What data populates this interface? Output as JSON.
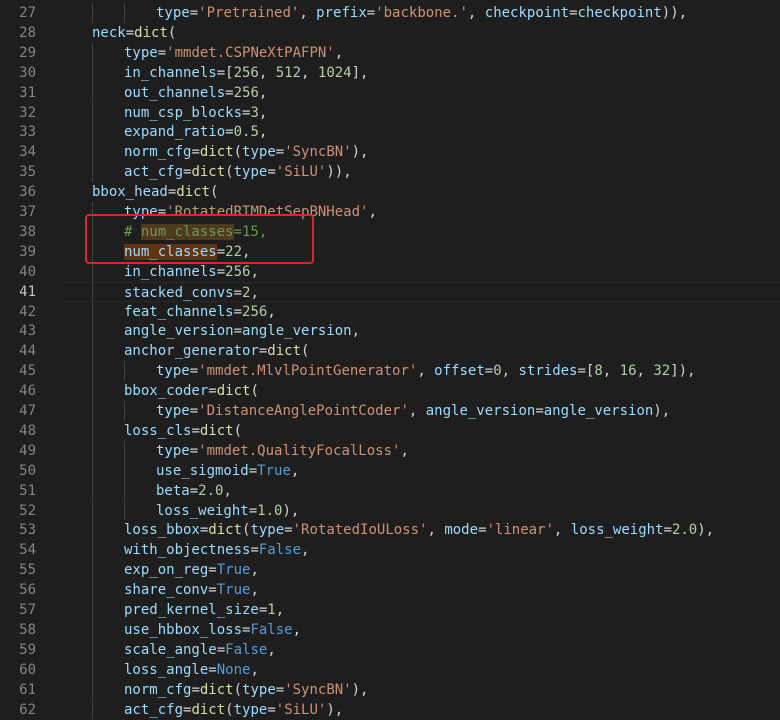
{
  "editor": {
    "active_line": 41,
    "lines": [
      {
        "n": "27",
        "indent": 3,
        "tokens": [
          [
            "k",
            "type"
          ],
          [
            "p",
            "="
          ],
          [
            "s",
            "'Pretrained'"
          ],
          [
            "p",
            ", "
          ],
          [
            "k",
            "prefix"
          ],
          [
            "p",
            "="
          ],
          [
            "s",
            "'backbone.'"
          ],
          [
            "p",
            ", "
          ],
          [
            "k",
            "checkpoint"
          ],
          [
            "p",
            "="
          ],
          [
            "k",
            "checkpoint"
          ],
          [
            "p",
            ")),"
          ]
        ]
      },
      {
        "n": "28",
        "indent": 1,
        "tokens": [
          [
            "k",
            "neck"
          ],
          [
            "p",
            "="
          ],
          [
            "f",
            "dict"
          ],
          [
            "p",
            "("
          ]
        ]
      },
      {
        "n": "29",
        "indent": 2,
        "tokens": [
          [
            "k",
            "type"
          ],
          [
            "p",
            "="
          ],
          [
            "s",
            "'mmdet.CSPNeXtPAFPN'"
          ],
          [
            "p",
            ","
          ]
        ]
      },
      {
        "n": "30",
        "indent": 2,
        "tokens": [
          [
            "k",
            "in_channels"
          ],
          [
            "p",
            "=["
          ],
          [
            "n",
            "256"
          ],
          [
            "p",
            ", "
          ],
          [
            "n",
            "512"
          ],
          [
            "p",
            ", "
          ],
          [
            "n",
            "1024"
          ],
          [
            "p",
            "],"
          ]
        ]
      },
      {
        "n": "31",
        "indent": 2,
        "tokens": [
          [
            "k",
            "out_channels"
          ],
          [
            "p",
            "="
          ],
          [
            "n",
            "256"
          ],
          [
            "p",
            ","
          ]
        ]
      },
      {
        "n": "32",
        "indent": 2,
        "tokens": [
          [
            "k",
            "num_csp_blocks"
          ],
          [
            "p",
            "="
          ],
          [
            "n",
            "3"
          ],
          [
            "p",
            ","
          ]
        ]
      },
      {
        "n": "33",
        "indent": 2,
        "tokens": [
          [
            "k",
            "expand_ratio"
          ],
          [
            "p",
            "="
          ],
          [
            "n",
            "0.5"
          ],
          [
            "p",
            ","
          ]
        ]
      },
      {
        "n": "34",
        "indent": 2,
        "tokens": [
          [
            "k",
            "norm_cfg"
          ],
          [
            "p",
            "="
          ],
          [
            "f",
            "dict"
          ],
          [
            "p",
            "("
          ],
          [
            "k",
            "type"
          ],
          [
            "p",
            "="
          ],
          [
            "s",
            "'SyncBN'"
          ],
          [
            "p",
            "),"
          ]
        ]
      },
      {
        "n": "35",
        "indent": 2,
        "tokens": [
          [
            "k",
            "act_cfg"
          ],
          [
            "p",
            "="
          ],
          [
            "f",
            "dict"
          ],
          [
            "p",
            "("
          ],
          [
            "k",
            "type"
          ],
          [
            "p",
            "="
          ],
          [
            "s",
            "'SiLU'"
          ],
          [
            "p",
            ")),"
          ]
        ]
      },
      {
        "n": "36",
        "indent": 1,
        "tokens": [
          [
            "k",
            "bbox_head"
          ],
          [
            "p",
            "="
          ],
          [
            "f",
            "dict"
          ],
          [
            "p",
            "("
          ]
        ]
      },
      {
        "n": "37",
        "indent": 2,
        "tokens": [
          [
            "k",
            "type"
          ],
          [
            "p",
            "="
          ],
          [
            "s",
            "'RotatedRTMDetSepBNHead'"
          ],
          [
            "p",
            ","
          ]
        ]
      },
      {
        "n": "38",
        "indent": 2,
        "tokens": [
          [
            "c",
            "# "
          ],
          [
            "c",
            "num_classes",
            "hl-find2"
          ],
          [
            "c",
            "=15,"
          ]
        ]
      },
      {
        "n": "39",
        "indent": 2,
        "tokens": [
          [
            "k",
            "num_classes",
            "hl-find"
          ],
          [
            "p",
            "="
          ],
          [
            "n",
            "22"
          ],
          [
            "p",
            ","
          ]
        ]
      },
      {
        "n": "40",
        "indent": 2,
        "tokens": [
          [
            "k",
            "in_channels"
          ],
          [
            "p",
            "="
          ],
          [
            "n",
            "256"
          ],
          [
            "p",
            ","
          ]
        ]
      },
      {
        "n": "41",
        "indent": 2,
        "tokens": [
          [
            "k",
            "stacked_convs"
          ],
          [
            "p",
            "="
          ],
          [
            "n",
            "2"
          ],
          [
            "p",
            ","
          ]
        ]
      },
      {
        "n": "42",
        "indent": 2,
        "tokens": [
          [
            "k",
            "feat_channels"
          ],
          [
            "p",
            "="
          ],
          [
            "n",
            "256"
          ],
          [
            "p",
            ","
          ]
        ]
      },
      {
        "n": "43",
        "indent": 2,
        "tokens": [
          [
            "k",
            "angle_version"
          ],
          [
            "p",
            "="
          ],
          [
            "k",
            "angle_version"
          ],
          [
            "p",
            ","
          ]
        ]
      },
      {
        "n": "44",
        "indent": 2,
        "tokens": [
          [
            "k",
            "anchor_generator"
          ],
          [
            "p",
            "="
          ],
          [
            "f",
            "dict"
          ],
          [
            "p",
            "("
          ]
        ]
      },
      {
        "n": "45",
        "indent": 3,
        "tokens": [
          [
            "k",
            "type"
          ],
          [
            "p",
            "="
          ],
          [
            "s",
            "'mmdet.MlvlPointGenerator'"
          ],
          [
            "p",
            ", "
          ],
          [
            "k",
            "offset"
          ],
          [
            "p",
            "="
          ],
          [
            "n",
            "0"
          ],
          [
            "p",
            ", "
          ],
          [
            "k",
            "strides"
          ],
          [
            "p",
            "=["
          ],
          [
            "n",
            "8"
          ],
          [
            "p",
            ", "
          ],
          [
            "n",
            "16"
          ],
          [
            "p",
            ", "
          ],
          [
            "n",
            "32"
          ],
          [
            "p",
            "]),"
          ]
        ]
      },
      {
        "n": "46",
        "indent": 2,
        "tokens": [
          [
            "k",
            "bbox_coder"
          ],
          [
            "p",
            "="
          ],
          [
            "f",
            "dict"
          ],
          [
            "p",
            "("
          ]
        ]
      },
      {
        "n": "47",
        "indent": 3,
        "tokens": [
          [
            "k",
            "type"
          ],
          [
            "p",
            "="
          ],
          [
            "s",
            "'DistanceAnglePointCoder'"
          ],
          [
            "p",
            ", "
          ],
          [
            "k",
            "angle_version"
          ],
          [
            "p",
            "="
          ],
          [
            "k",
            "angle_version"
          ],
          [
            "p",
            "),"
          ]
        ]
      },
      {
        "n": "48",
        "indent": 2,
        "tokens": [
          [
            "k",
            "loss_cls"
          ],
          [
            "p",
            "="
          ],
          [
            "f",
            "dict"
          ],
          [
            "p",
            "("
          ]
        ]
      },
      {
        "n": "49",
        "indent": 3,
        "tokens": [
          [
            "k",
            "type"
          ],
          [
            "p",
            "="
          ],
          [
            "s",
            "'mmdet.QualityFocalLoss'"
          ],
          [
            "p",
            ","
          ]
        ]
      },
      {
        "n": "50",
        "indent": 3,
        "tokens": [
          [
            "k",
            "use_sigmoid"
          ],
          [
            "p",
            "="
          ],
          [
            "b",
            "True"
          ],
          [
            "p",
            ","
          ]
        ]
      },
      {
        "n": "51",
        "indent": 3,
        "tokens": [
          [
            "k",
            "beta"
          ],
          [
            "p",
            "="
          ],
          [
            "n",
            "2.0"
          ],
          [
            "p",
            ","
          ]
        ]
      },
      {
        "n": "52",
        "indent": 3,
        "tokens": [
          [
            "k",
            "loss_weight"
          ],
          [
            "p",
            "="
          ],
          [
            "n",
            "1.0"
          ],
          [
            "p",
            "),"
          ]
        ]
      },
      {
        "n": "53",
        "indent": 2,
        "tokens": [
          [
            "k",
            "loss_bbox"
          ],
          [
            "p",
            "="
          ],
          [
            "f",
            "dict"
          ],
          [
            "p",
            "("
          ],
          [
            "k",
            "type"
          ],
          [
            "p",
            "="
          ],
          [
            "s",
            "'RotatedIoULoss'"
          ],
          [
            "p",
            ", "
          ],
          [
            "k",
            "mode"
          ],
          [
            "p",
            "="
          ],
          [
            "s",
            "'linear'"
          ],
          [
            "p",
            ", "
          ],
          [
            "k",
            "loss_weight"
          ],
          [
            "p",
            "="
          ],
          [
            "n",
            "2.0"
          ],
          [
            "p",
            "),"
          ]
        ]
      },
      {
        "n": "54",
        "indent": 2,
        "tokens": [
          [
            "k",
            "with_objectness"
          ],
          [
            "p",
            "="
          ],
          [
            "b",
            "False"
          ],
          [
            "p",
            ","
          ]
        ]
      },
      {
        "n": "55",
        "indent": 2,
        "tokens": [
          [
            "k",
            "exp_on_reg"
          ],
          [
            "p",
            "="
          ],
          [
            "b",
            "True"
          ],
          [
            "p",
            ","
          ]
        ]
      },
      {
        "n": "56",
        "indent": 2,
        "tokens": [
          [
            "k",
            "share_conv"
          ],
          [
            "p",
            "="
          ],
          [
            "b",
            "True"
          ],
          [
            "p",
            ","
          ]
        ]
      },
      {
        "n": "57",
        "indent": 2,
        "tokens": [
          [
            "k",
            "pred_kernel_size"
          ],
          [
            "p",
            "="
          ],
          [
            "n",
            "1"
          ],
          [
            "p",
            ","
          ]
        ]
      },
      {
        "n": "58",
        "indent": 2,
        "tokens": [
          [
            "k",
            "use_hbbox_loss"
          ],
          [
            "p",
            "="
          ],
          [
            "b",
            "False"
          ],
          [
            "p",
            ","
          ]
        ]
      },
      {
        "n": "59",
        "indent": 2,
        "tokens": [
          [
            "k",
            "scale_angle"
          ],
          [
            "p",
            "="
          ],
          [
            "b",
            "False"
          ],
          [
            "p",
            ","
          ]
        ]
      },
      {
        "n": "60",
        "indent": 2,
        "tokens": [
          [
            "k",
            "loss_angle"
          ],
          [
            "p",
            "="
          ],
          [
            "b",
            "None"
          ],
          [
            "p",
            ","
          ]
        ]
      },
      {
        "n": "61",
        "indent": 2,
        "tokens": [
          [
            "k",
            "norm_cfg"
          ],
          [
            "p",
            "="
          ],
          [
            "f",
            "dict"
          ],
          [
            "p",
            "("
          ],
          [
            "k",
            "type"
          ],
          [
            "p",
            "="
          ],
          [
            "s",
            "'SyncBN'"
          ],
          [
            "p",
            "),"
          ]
        ]
      },
      {
        "n": "62",
        "indent": 2,
        "tokens": [
          [
            "k",
            "act_cfg"
          ],
          [
            "p",
            "="
          ],
          [
            "f",
            "dict"
          ],
          [
            "p",
            "("
          ],
          [
            "k",
            "type"
          ],
          [
            "p",
            "="
          ],
          [
            "s",
            "'SiLU'"
          ],
          [
            "p",
            "),"
          ]
        ]
      }
    ]
  }
}
